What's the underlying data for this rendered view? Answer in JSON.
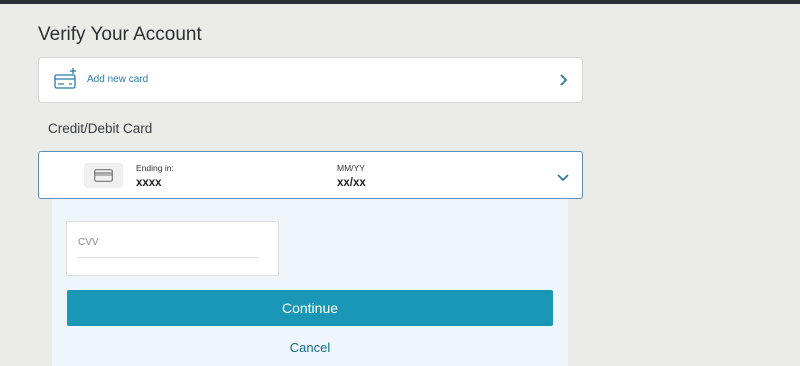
{
  "page": {
    "title": "Verify Your Account"
  },
  "add_card": {
    "label": "Add new card",
    "icon": "add-card-icon"
  },
  "section": {
    "label": "Credit/Debit Card"
  },
  "selected_card": {
    "ending_label": "Ending in:",
    "ending_value": "xxxx",
    "expiry_label": "MM/YY",
    "expiry_value": "xx/xx"
  },
  "cvv": {
    "placeholder": "CVV"
  },
  "actions": {
    "continue_label": "Continue",
    "cancel_label": "Cancel"
  },
  "colors": {
    "accent": "#1a96b7",
    "link": "#2a7bab",
    "panel_bg": "#eef6fb",
    "page_bg": "#ebebe8"
  }
}
